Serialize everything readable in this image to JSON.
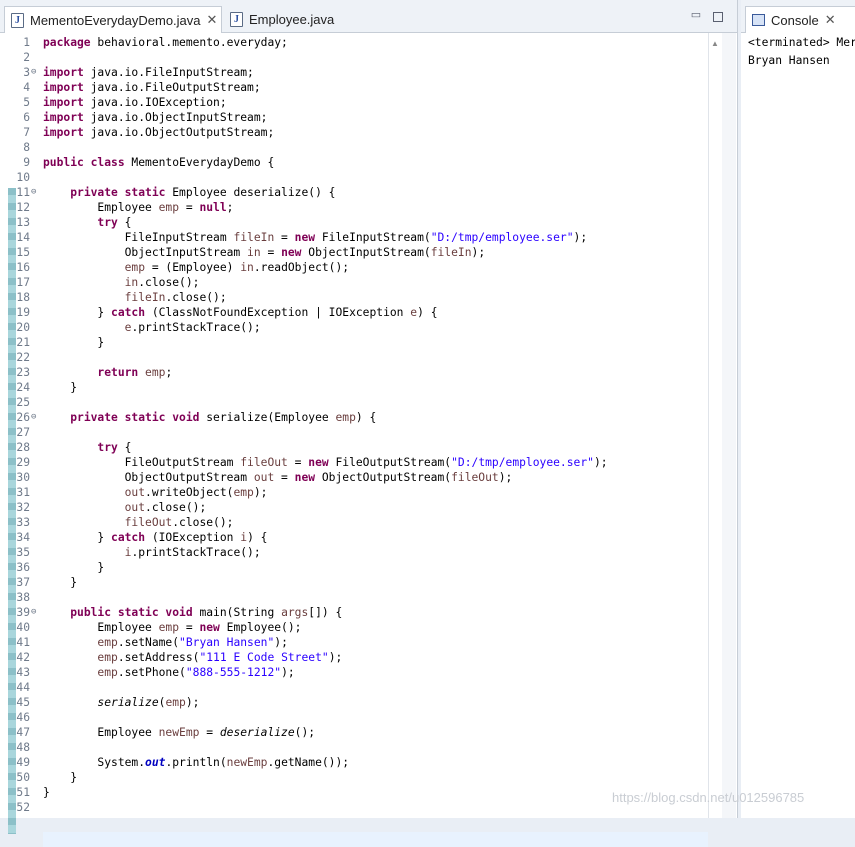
{
  "editor": {
    "tabs": [
      {
        "label": "MementoEverydayDemo.java",
        "active": true
      },
      {
        "label": "Employee.java",
        "active": false
      }
    ],
    "lines": [
      {
        "n": "1",
        "m": "",
        "h": "<span class=\"kw\">package</span> behavioral.memento.everyday;"
      },
      {
        "n": "2",
        "m": "",
        "h": ""
      },
      {
        "n": "3",
        "m": "⊖",
        "h": "<span class=\"kw\">import</span> java.io.FileInputStream;"
      },
      {
        "n": "4",
        "m": "",
        "h": "<span class=\"kw\">import</span> java.io.FileOutputStream;"
      },
      {
        "n": "5",
        "m": "",
        "h": "<span class=\"kw\">import</span> java.io.IOException;"
      },
      {
        "n": "6",
        "m": "",
        "h": "<span class=\"kw\">import</span> java.io.ObjectInputStream;"
      },
      {
        "n": "7",
        "m": "",
        "h": "<span class=\"kw\">import</span> java.io.ObjectOutputStream;"
      },
      {
        "n": "8",
        "m": "",
        "h": ""
      },
      {
        "n": "9",
        "m": "",
        "h": "<span class=\"kw\">public class</span> MementoEverydayDemo {"
      },
      {
        "n": "10",
        "m": "",
        "h": ""
      },
      {
        "n": "11",
        "m": "⊖",
        "h": "    <span class=\"kw\">private static</span> Employee deserialize() {"
      },
      {
        "n": "12",
        "m": "",
        "h": "        Employee <span class=\"lvar\">emp</span> = <span class=\"kw\">null</span>;"
      },
      {
        "n": "13",
        "m": "",
        "h": "        <span class=\"kw\">try</span> {"
      },
      {
        "n": "14",
        "m": "",
        "h": "            FileInputStream <span class=\"lvar\">fileIn</span> = <span class=\"kw\">new</span> FileInputStream(<span class=\"str\">\"D:/tmp/employee.ser\"</span>);"
      },
      {
        "n": "15",
        "m": "",
        "h": "            ObjectInputStream <span class=\"lvar\">in</span> = <span class=\"kw\">new</span> ObjectInputStream(<span class=\"lvar\">fileIn</span>);"
      },
      {
        "n": "16",
        "m": "",
        "h": "            <span class=\"lvar\">emp</span> = (Employee) <span class=\"lvar\">in</span>.readObject();"
      },
      {
        "n": "17",
        "m": "",
        "h": "            <span class=\"lvar\">in</span>.close();"
      },
      {
        "n": "18",
        "m": "",
        "h": "            <span class=\"lvar\">fileIn</span>.close();"
      },
      {
        "n": "19",
        "m": "",
        "h": "        } <span class=\"kw\">catch</span> (ClassNotFoundException | IOException <span class=\"lvar\">e</span>) {"
      },
      {
        "n": "20",
        "m": "",
        "h": "            <span class=\"lvar\">e</span>.printStackTrace();"
      },
      {
        "n": "21",
        "m": "",
        "h": "        }"
      },
      {
        "n": "22",
        "m": "",
        "h": ""
      },
      {
        "n": "23",
        "m": "",
        "h": "        <span class=\"kw\">return</span> <span class=\"lvar\">emp</span>;"
      },
      {
        "n": "24",
        "m": "",
        "h": "    }"
      },
      {
        "n": "25",
        "m": "",
        "h": ""
      },
      {
        "n": "26",
        "m": "⊖",
        "h": "    <span class=\"kw\">private static void</span> serialize(Employee <span class=\"lvar\">emp</span>) {"
      },
      {
        "n": "27",
        "m": "",
        "h": ""
      },
      {
        "n": "28",
        "m": "",
        "h": "        <span class=\"kw\">try</span> {"
      },
      {
        "n": "29",
        "m": "",
        "h": "            FileOutputStream <span class=\"lvar\">fileOut</span> = <span class=\"kw\">new</span> FileOutputStream(<span class=\"str\">\"D:/tmp/employee.ser\"</span>);"
      },
      {
        "n": "30",
        "m": "",
        "h": "            ObjectOutputStream <span class=\"lvar\">out</span> = <span class=\"kw\">new</span> ObjectOutputStream(<span class=\"lvar\">fileOut</span>);"
      },
      {
        "n": "31",
        "m": "",
        "h": "            <span class=\"lvar\">out</span>.writeObject(<span class=\"lvar\">emp</span>);"
      },
      {
        "n": "32",
        "m": "",
        "h": "            <span class=\"lvar\">out</span>.close();"
      },
      {
        "n": "33",
        "m": "",
        "h": "            <span class=\"lvar\">fileOut</span>.close();"
      },
      {
        "n": "34",
        "m": "",
        "h": "        } <span class=\"kw\">catch</span> (IOException <span class=\"lvar\">i</span>) {"
      },
      {
        "n": "35",
        "m": "",
        "h": "            <span class=\"lvar\">i</span>.printStackTrace();"
      },
      {
        "n": "36",
        "m": "",
        "h": "        }"
      },
      {
        "n": "37",
        "m": "",
        "h": "    }"
      },
      {
        "n": "38",
        "m": "",
        "h": ""
      },
      {
        "n": "39",
        "m": "⊖",
        "h": "    <span class=\"kw\">public static void</span> main(String <span class=\"lvar\">args</span>[]) {"
      },
      {
        "n": "40",
        "m": "",
        "h": "        Employee <span class=\"lvar\">emp</span> = <span class=\"kw\">new</span> Employee();"
      },
      {
        "n": "41",
        "m": "",
        "h": "        <span class=\"lvar\">emp</span>.setName(<span class=\"str\">\"Bryan Hansen\"</span>);"
      },
      {
        "n": "42",
        "m": "",
        "h": "        <span class=\"lvar\">emp</span>.setAddress(<span class=\"str\">\"111 E Code Street\"</span>);"
      },
      {
        "n": "43",
        "m": "",
        "h": "        <span class=\"lvar\">emp</span>.setPhone(<span class=\"str\">\"888-555-1212\"</span>);"
      },
      {
        "n": "44",
        "m": "",
        "h": ""
      },
      {
        "n": "45",
        "m": "",
        "h": "        <span class=\"it\">serialize</span>(<span class=\"lvar\">emp</span>);"
      },
      {
        "n": "46",
        "m": "",
        "h": ""
      },
      {
        "n": "47",
        "m": "",
        "h": "        Employee <span class=\"lvar\">newEmp</span> = <span class=\"it\">deserialize</span>();"
      },
      {
        "n": "48",
        "m": "",
        "h": ""
      },
      {
        "n": "49",
        "m": "",
        "h": "        System.<span class=\"fld it\"><b>out</b></span>.println(<span class=\"lvar\">newEmp</span>.getName());"
      },
      {
        "n": "50",
        "m": "",
        "h": "    }"
      },
      {
        "n": "51",
        "m": "",
        "h": "}"
      },
      {
        "n": "52",
        "m": "",
        "h": ""
      }
    ]
  },
  "console": {
    "tab_label": "Console",
    "lines": [
      "<terminated> Mer",
      "Bryan Hansen"
    ]
  },
  "watermark": "https://blog.csdn.net/u012596785",
  "colors": {
    "keyword": "#7f0055",
    "string": "#2a00ff",
    "local_var": "#6a3e3e",
    "field": "#0000c0"
  }
}
